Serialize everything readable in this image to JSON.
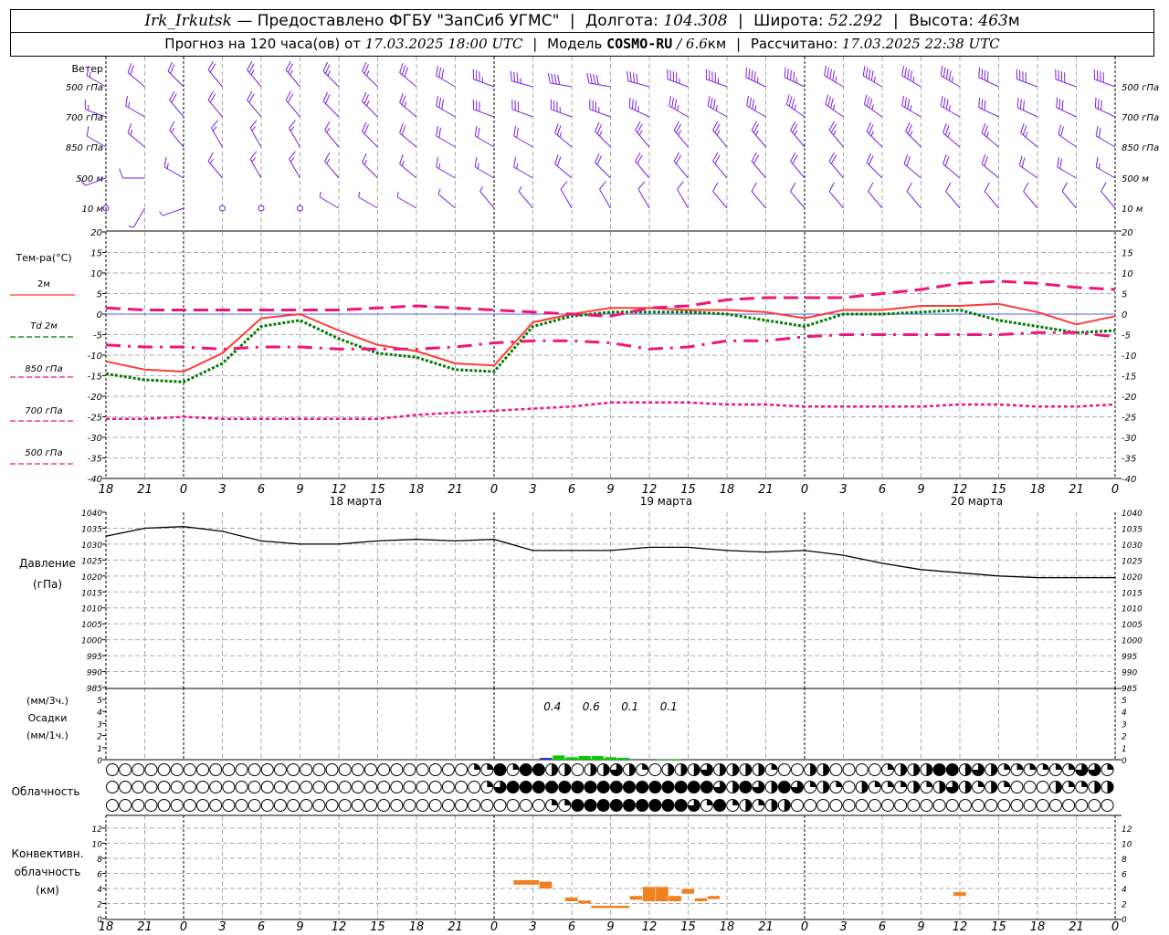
{
  "header": {
    "station": "Irk_Irkutsk",
    "provided_by": "— Предоставлено ФГБУ \"ЗапСиб УГМС\"",
    "lon_label": "Долгота:",
    "lon": "104.308",
    "lat_label": "Широта:",
    "lat": "52.292",
    "alt_label": "Высота:",
    "alt": "463",
    "alt_unit": "м",
    "forecast_label": "Прогноз на 120 часа(ов) от",
    "forecast_time": "17.03.2025 18:00 UTC",
    "model_label": "Модель",
    "model": "COSMO-RU",
    "resolution": "/ 6.6",
    "resolution_unit": "км",
    "computed_label": "Рассчитано:",
    "computed_time": "17.03.2025 22:38 UTC"
  },
  "labels": {
    "wind_title": "Ветер",
    "wind_levels": [
      "500 гПа",
      "700 гПа",
      "850 гПа",
      "500 м",
      "10  м"
    ],
    "temp_title": "Тем-ра(°C)",
    "temp_legend": [
      "2м",
      "Td  2м",
      "850 гПа",
      "700 гПа",
      "500 гПа"
    ],
    "pressure": [
      "Давление",
      "(гПа)"
    ],
    "precip": [
      "(мм/3ч.)",
      "Осадки",
      "(мм/1ч.)"
    ],
    "cloud": "Облачность",
    "conv": [
      "Конвективн.",
      "облачность",
      "(км)"
    ]
  },
  "colors": {
    "t2m": "#ff3b30",
    "td2m": "#007a00",
    "t850": "#f0147a",
    "t700": "#f0147a",
    "t500": "#f0147a",
    "wind": "#7a1fe0",
    "precip_rain": "#00cc00",
    "precip_snow": "#2030e0",
    "conv": "#f08020",
    "zero": "#2040ff"
  },
  "chart_data": {
    "type": "meteogram",
    "hours": [
      0,
      3,
      6,
      9,
      12,
      15,
      18,
      21,
      24,
      27,
      30,
      33,
      36,
      39,
      42,
      45,
      48,
      51,
      54,
      57,
      60,
      63,
      66,
      69,
      72,
      75,
      78
    ],
    "x_tick_labels": [
      "18",
      "21",
      "0",
      "3",
      "6",
      "9",
      "12",
      "15",
      "18",
      "21",
      "0",
      "3",
      "6",
      "9",
      "12",
      "15",
      "18",
      "21",
      "0",
      "3",
      "6",
      "9",
      "12",
      "15",
      "18",
      "21",
      "0"
    ],
    "dates": [
      {
        "h": 19.3,
        "label": "18 марта"
      },
      {
        "h": 43.3,
        "label": "19 марта"
      },
      {
        "h": 67.3,
        "label": "20 марта"
      }
    ],
    "day_boundaries_h": [
      6,
      30,
      54,
      78
    ],
    "wind": {
      "units": "kt",
      "levels": [
        {
          "dir": [
            300,
            310,
            315,
            320,
            320,
            320,
            315,
            315,
            310,
            300,
            290,
            285,
            280,
            280,
            285,
            290,
            290,
            295,
            295,
            300,
            300,
            300,
            300,
            295,
            290,
            290,
            290
          ],
          "spd": [
            15,
            20,
            20,
            20,
            25,
            25,
            25,
            25,
            30,
            30,
            35,
            35,
            40,
            40,
            40,
            45,
            45,
            45,
            45,
            45,
            45,
            45,
            45,
            40,
            40,
            40,
            40
          ]
        },
        {
          "dir": [
            290,
            300,
            320,
            320,
            320,
            320,
            315,
            315,
            310,
            300,
            290,
            290,
            290,
            290,
            295,
            300,
            300,
            300,
            305,
            305,
            305,
            300,
            300,
            295,
            295,
            295,
            295
          ],
          "spd": [
            15,
            15,
            20,
            20,
            20,
            20,
            20,
            25,
            25,
            30,
            30,
            30,
            35,
            35,
            35,
            35,
            35,
            35,
            35,
            35,
            35,
            35,
            35,
            30,
            30,
            30,
            30
          ]
        },
        {
          "dir": [
            300,
            310,
            320,
            330,
            330,
            330,
            320,
            315,
            310,
            300,
            300,
            300,
            310,
            315,
            320,
            320,
            320,
            320,
            320,
            320,
            315,
            315,
            310,
            310,
            310,
            305,
            300
          ],
          "spd": [
            10,
            15,
            15,
            15,
            15,
            15,
            15,
            20,
            20,
            20,
            20,
            20,
            25,
            25,
            25,
            25,
            25,
            25,
            25,
            25,
            25,
            25,
            25,
            25,
            25,
            20,
            20
          ]
        },
        {
          "dir": [
            250,
            270,
            300,
            320,
            330,
            330,
            320,
            315,
            310,
            300,
            300,
            300,
            310,
            315,
            320,
            320,
            320,
            320,
            320,
            320,
            315,
            310,
            310,
            310,
            305,
            300,
            300
          ],
          "spd": [
            10,
            10,
            15,
            15,
            15,
            15,
            15,
            15,
            15,
            15,
            15,
            15,
            20,
            20,
            20,
            20,
            20,
            20,
            20,
            20,
            20,
            20,
            20,
            20,
            20,
            20,
            15
          ]
        },
        {
          "dir": [
            0,
            210,
            250,
            0,
            0,
            0,
            300,
            300,
            300,
            310,
            320,
            320,
            330,
            330,
            330,
            330,
            320,
            320,
            320,
            320,
            320,
            320,
            320,
            320,
            320,
            320,
            320
          ],
          "spd": [
            0,
            5,
            5,
            0,
            0,
            0,
            5,
            5,
            5,
            5,
            5,
            5,
            10,
            10,
            10,
            10,
            10,
            10,
            10,
            10,
            10,
            10,
            10,
            10,
            10,
            10,
            10
          ]
        }
      ]
    },
    "temperature": {
      "ylim": [
        -40,
        20
      ],
      "ticks": [
        20,
        15,
        10,
        5,
        0,
        -5,
        -10,
        -15,
        -20,
        -25,
        -30,
        -35,
        -40
      ],
      "series": [
        {
          "name": "2м",
          "key": "t2m",
          "values": [
            -11.5,
            -13.5,
            -14,
            -9.5,
            -1,
            0,
            -4,
            -7.5,
            -9,
            -12,
            -12.5,
            -2,
            0,
            1.5,
            1.5,
            1,
            1,
            0.5,
            -1,
            1,
            1,
            2,
            2,
            2.5,
            0.5,
            -2.5,
            -0.5
          ]
        },
        {
          "name": "Td 2м",
          "key": "td2m",
          "values": [
            -14.5,
            -16,
            -16.5,
            -12,
            -3,
            -1.5,
            -6,
            -9.5,
            -10.5,
            -13.5,
            -14,
            -3,
            -0.5,
            0.5,
            0.5,
            0.5,
            0,
            -1.5,
            -3,
            0,
            0,
            0.5,
            1,
            -1.5,
            -3,
            -4.5,
            -4
          ]
        },
        {
          "name": "850 гПа",
          "key": "t850",
          "values": [
            1.5,
            1,
            1,
            1,
            1,
            1,
            1,
            1.5,
            2,
            1.5,
            1,
            0.5,
            0,
            -0.5,
            1.5,
            2,
            3.5,
            4,
            4,
            4,
            5,
            6,
            7.5,
            8,
            7.5,
            6.5,
            6
          ]
        },
        {
          "name": "700 гПа",
          "key": "t700",
          "values": [
            -7.5,
            -8,
            -8,
            -8.5,
            -8,
            -8,
            -8.5,
            -8.5,
            -8.5,
            -8,
            -7,
            -6.5,
            -6.5,
            -7,
            -8.5,
            -8,
            -6.5,
            -6.5,
            -5.5,
            -5,
            -5,
            -5,
            -5,
            -5,
            -4.5,
            -4.5,
            -5.5
          ]
        },
        {
          "name": "500 гПа",
          "key": "t500",
          "values": [
            -25.5,
            -25.5,
            -25,
            -25.5,
            -25.5,
            -25.5,
            -25.5,
            -25.5,
            -24.5,
            -24,
            -23.5,
            -23,
            -22.5,
            -21.5,
            -21.5,
            -21.5,
            -22,
            -22,
            -22.5,
            -22.5,
            -22.5,
            -22.5,
            -22,
            -22,
            -22.5,
            -22.5,
            -22
          ]
        }
      ]
    },
    "pressure": {
      "ylim": [
        985,
        1040
      ],
      "ticks": [
        1040,
        1035,
        1030,
        1025,
        1020,
        1015,
        1010,
        1005,
        1000,
        995,
        990,
        985
      ],
      "values": [
        1032.5,
        1035,
        1035.5,
        1034,
        1031,
        1030,
        1030,
        1031,
        1031.5,
        1031,
        1031.5,
        1028,
        1028,
        1028,
        1029,
        1029,
        1028,
        1027.5,
        1028,
        1026.5,
        1024,
        1022,
        1021,
        1020,
        1019.5,
        1019.5,
        1019.5
      ]
    },
    "precip": {
      "ylim": [
        0,
        5
      ],
      "ticks": [
        5,
        4,
        3,
        2,
        1,
        0
      ],
      "hourly": [
        {
          "h": 34,
          "mm": 0.15,
          "type": "snow"
        },
        {
          "h": 35,
          "mm": 0.35,
          "type": "rain"
        },
        {
          "h": 36,
          "mm": 0.2,
          "type": "rain"
        },
        {
          "h": 37,
          "mm": 0.3,
          "type": "rain"
        },
        {
          "h": 38,
          "mm": 0.3,
          "type": "rain"
        },
        {
          "h": 39,
          "mm": 0.2,
          "type": "rain"
        },
        {
          "h": 40,
          "mm": 0.15,
          "type": "rain"
        },
        {
          "h": 43,
          "mm": 0.05,
          "type": "rain"
        },
        {
          "h": 44,
          "mm": 0.05,
          "type": "rain"
        }
      ],
      "totals_3h": [
        {
          "h": 34.5,
          "label": "0.4"
        },
        {
          "h": 37.5,
          "label": "0.6"
        },
        {
          "h": 40.5,
          "label": "0.1"
        },
        {
          "h": 43.5,
          "label": "0.1"
        }
      ]
    },
    "cloud_cover_quarters": [
      "000000000000000000000000000011414422022321022232222100220000122244232111111331",
      "000000000000000000000000000001344444444444444443243243121021112123212100021122",
      "000000000000000000000000000000000011444444444314121220000000000000000000000000"
    ],
    "convective_cloud": {
      "ylim": [
        0,
        14
      ],
      "ticks": [
        12,
        10,
        8,
        6,
        4,
        2,
        0
      ],
      "bars": [
        {
          "h0": 31.5,
          "h1": 33.5,
          "base": 4.5,
          "top": 5.1
        },
        {
          "h0": 33.5,
          "h1": 34.5,
          "base": 4.0,
          "top": 4.9
        },
        {
          "h0": 35.5,
          "h1": 36.5,
          "base": 2.3,
          "top": 2.8
        },
        {
          "h0": 36.5,
          "h1": 37.5,
          "base": 2.0,
          "top": 2.4
        },
        {
          "h0": 37.5,
          "h1": 40.5,
          "base": 1.4,
          "top": 1.7
        },
        {
          "h0": 40.5,
          "h1": 41.5,
          "base": 2.5,
          "top": 3.0
        },
        {
          "h0": 41.5,
          "h1": 42.5,
          "base": 2.3,
          "top": 4.2
        },
        {
          "h0": 42.5,
          "h1": 43.5,
          "base": 2.3,
          "top": 4.2
        },
        {
          "h0": 43.5,
          "h1": 44.5,
          "base": 2.3,
          "top": 3.0
        },
        {
          "h0": 44.5,
          "h1": 45.5,
          "base": 3.3,
          "top": 3.9
        },
        {
          "h0": 45.5,
          "h1": 46.5,
          "base": 2.3,
          "top": 2.7
        },
        {
          "h0": 46.5,
          "h1": 47.5,
          "base": 2.6,
          "top": 3.0
        },
        {
          "h0": 65.5,
          "h1": 66.5,
          "base": 3.0,
          "top": 3.5
        }
      ]
    }
  }
}
